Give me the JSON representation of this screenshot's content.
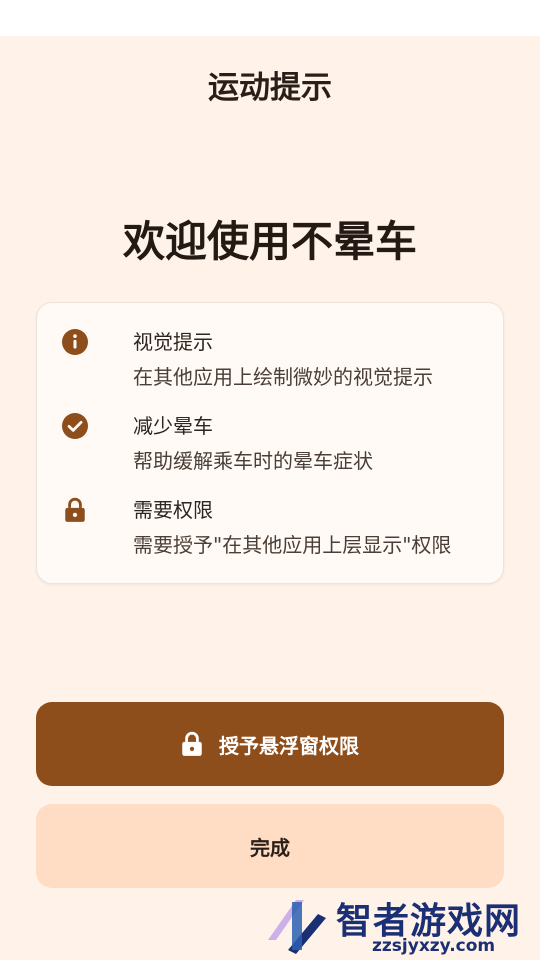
{
  "app_bar": {
    "title": "运动提示"
  },
  "welcome": {
    "heading": "欢迎使用不晕车"
  },
  "features": [
    {
      "icon": "info-icon",
      "title": "视觉提示",
      "desc": "在其他应用上绘制微妙的视觉提示"
    },
    {
      "icon": "check-circle-icon",
      "title": "减少晕车",
      "desc": "帮助缓解乘车时的晕车症状"
    },
    {
      "icon": "lock-icon",
      "title": "需要权限",
      "desc": "需要授予\"在其他应用上层显示\"权限"
    }
  ],
  "buttons": {
    "grant_label": "授予悬浮窗权限",
    "grant_icon": "lock-icon",
    "done_label": "完成"
  },
  "watermark": {
    "title": "智者游戏网",
    "url": "zzsjyxzy.com"
  },
  "colors": {
    "background": "#fff3e9",
    "primary": "#8e4e1b",
    "secondary": "#ffdcc4",
    "icon": "#8e4e1b"
  }
}
